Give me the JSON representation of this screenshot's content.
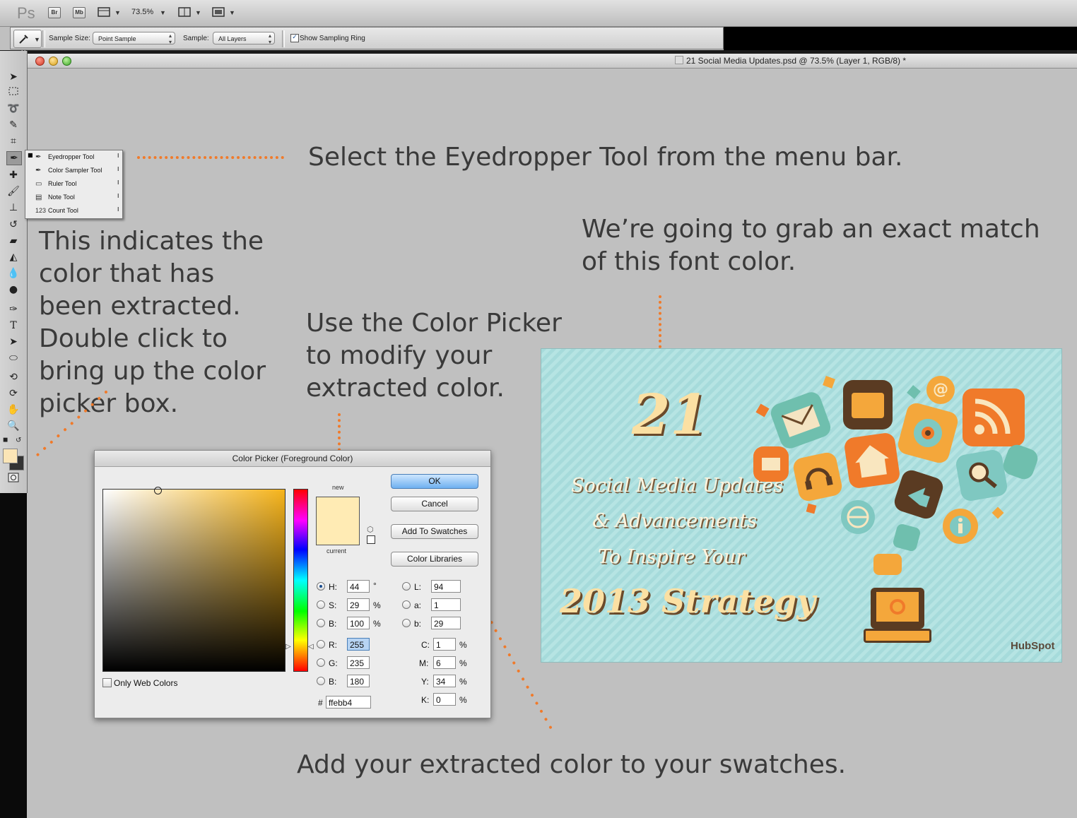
{
  "app": {
    "logo": "Ps",
    "bridge": "Br",
    "minibridge": "Mb",
    "zoom": "73.5%"
  },
  "options": {
    "sample_size_label": "Sample Size:",
    "sample_size_value": "Point Sample",
    "sample_label": "Sample:",
    "sample_value": "All Layers",
    "show_ring_label": "Show Sampling Ring"
  },
  "document": {
    "title": "21 Social Media Updates.psd @ 73.5% (Layer 1, RGB/8) *"
  },
  "flyout": {
    "items": [
      {
        "label": "Eyedropper Tool",
        "icon": "eyedropper-icon"
      },
      {
        "label": "Color Sampler Tool",
        "icon": "color-sampler-icon"
      },
      {
        "label": "Ruler Tool",
        "icon": "ruler-icon"
      },
      {
        "label": "Note Tool",
        "icon": "note-icon"
      },
      {
        "label": "Count Tool",
        "icon": "count-icon",
        "glyph": "123"
      }
    ]
  },
  "annotations": {
    "eyedropper": "Select the Eyedropper Tool from the menu bar.",
    "indicates": "This indicates the color that has been extracted. Double click to bring up the color picker box.",
    "grab": "We’re going to grab an exact match of this font color.",
    "use_picker": "Use the Color Picker to modify your extracted color.",
    "swatches": "Add your extracted color to your swatches."
  },
  "picker": {
    "title": "Color Picker (Foreground Color)",
    "new_label": "new",
    "current_label": "current",
    "ok": "OK",
    "cancel": "Cancel",
    "add_swatches": "Add To Swatches",
    "libraries": "Color Libraries",
    "only_web": "Only Web Colors",
    "h_label": "H:",
    "h": "44",
    "h_unit": "°",
    "s_label": "S:",
    "s": "29",
    "s_unit": "%",
    "b_label": "B:",
    "b": "100",
    "b_unit": "%",
    "r_label": "R:",
    "r": "255",
    "g_label": "G:",
    "g": "235",
    "bl_label": "B:",
    "bl": "180",
    "l_label": "L:",
    "l": "94",
    "a_label": "a:",
    "a": "1",
    "lb_label": "b:",
    "lb": "29",
    "c_label": "C:",
    "c": "1",
    "c_unit": "%",
    "m_label": "M:",
    "m": "6",
    "m_unit": "%",
    "y_label": "Y:",
    "y": "34",
    "y_unit": "%",
    "k_label": "K:",
    "k": "0",
    "k_unit": "%",
    "hex_label": "#",
    "hex": "ffebb4",
    "color_new": "#ffebb4",
    "color_current": "#ffebb4"
  },
  "artwork": {
    "number": "21",
    "line1": "Social Media Updates",
    "line2": "& Advancements",
    "line3": "To Inspire Your",
    "line4": "2013 Strategy",
    "brand": "HubSpot"
  },
  "colors": {
    "accent_dots": "#f07a2a",
    "foreground": "#fbe5b6"
  }
}
